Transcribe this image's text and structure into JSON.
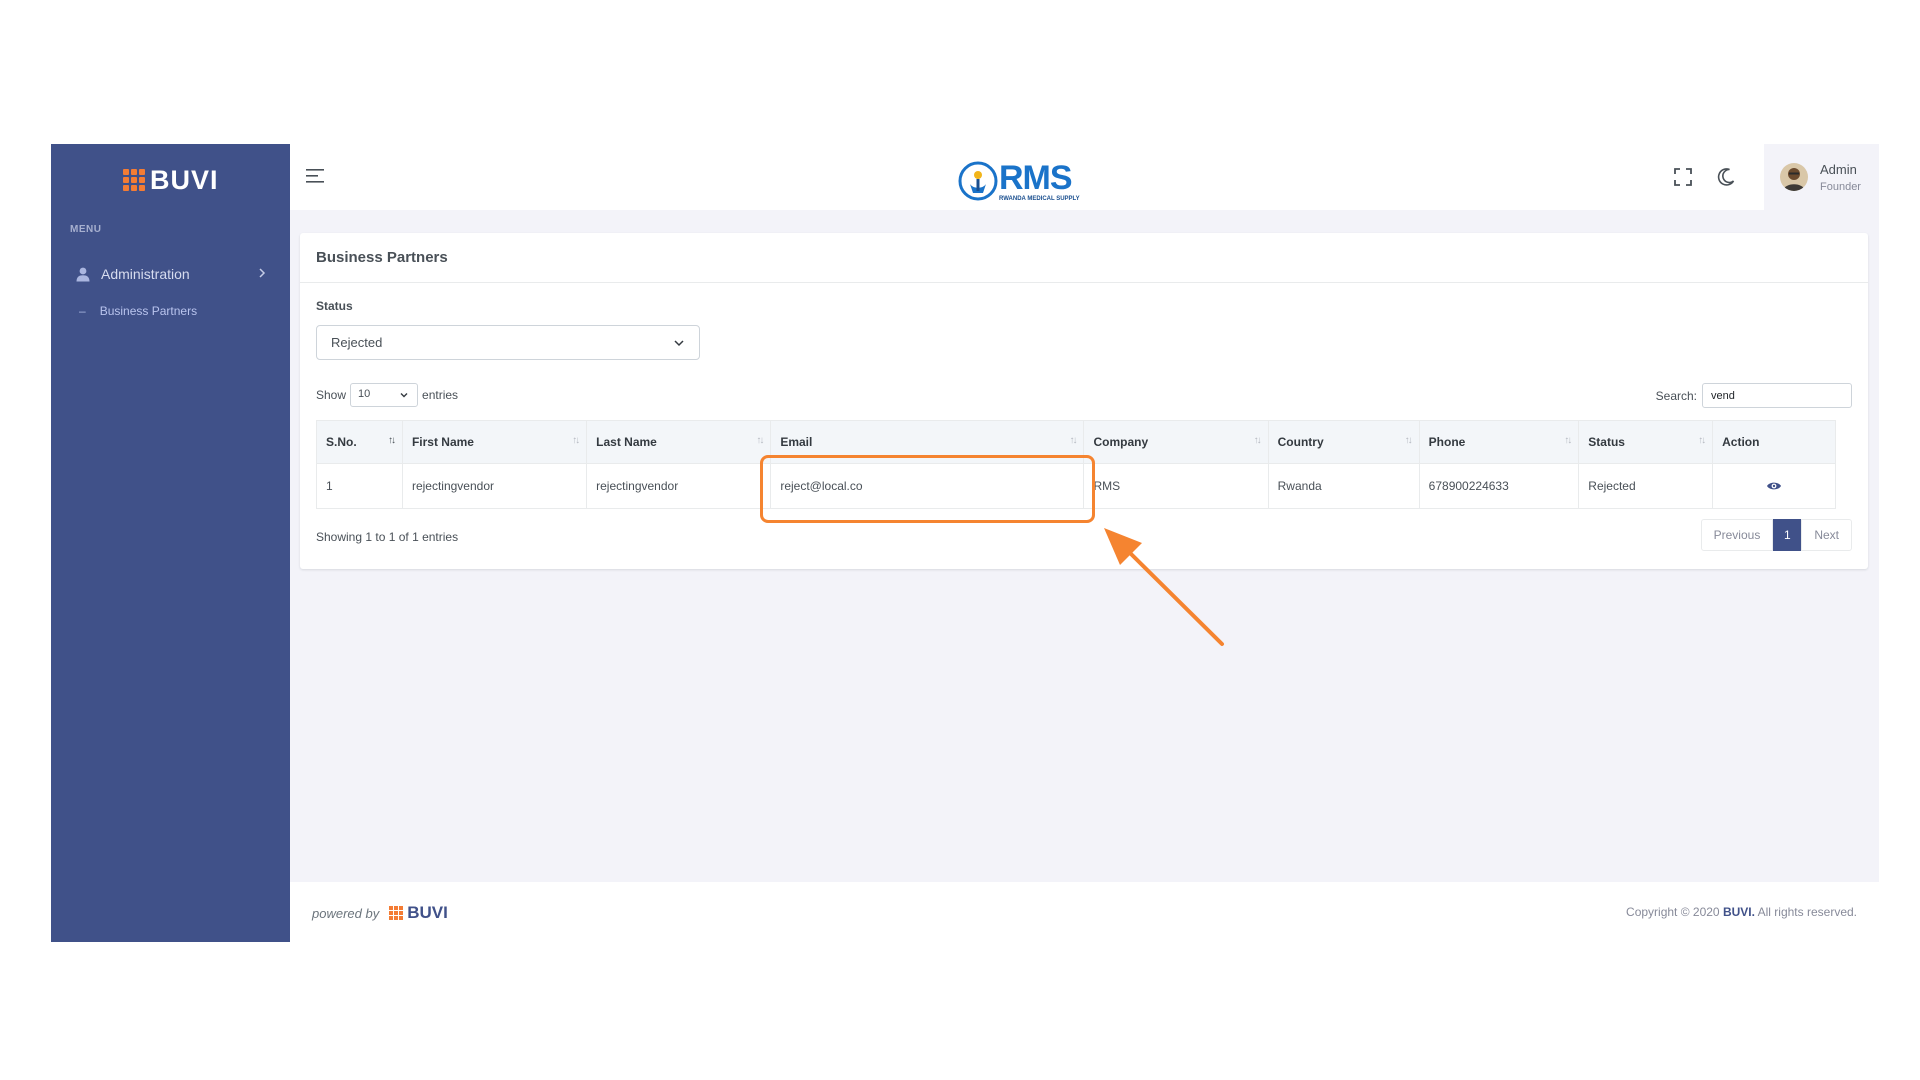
{
  "sidebar": {
    "brand": "BUVI",
    "menu_title": "MENU",
    "items": [
      {
        "label": "Administration",
        "icon": "user-icon"
      }
    ],
    "sub_items": [
      {
        "label": "Business Partners"
      }
    ]
  },
  "header": {
    "logo_main": "RMS",
    "logo_sub": "RWANDA MEDICAL SUPPLY",
    "user": {
      "name": "Admin",
      "role": "Founder"
    }
  },
  "card": {
    "title": "Business Partners",
    "status_label": "Status",
    "status_value": "Rejected",
    "show_label": "Show",
    "entries_value": "10",
    "entries_label": "entries",
    "search_label": "Search:",
    "search_value": "vend",
    "columns": [
      "S.No.",
      "First Name",
      "Last Name",
      "Email",
      "Company",
      "Country",
      "Phone",
      "Status",
      "Action"
    ],
    "rows": [
      {
        "sno": "1",
        "first_name": "rejectingvendor",
        "last_name": "rejectingvendor",
        "email": "reject@local.co",
        "company": "RMS",
        "country": "Rwanda",
        "phone": "678900224633",
        "status": "Rejected"
      }
    ],
    "info": "Showing 1 to 1 of 1 entries",
    "pagination": {
      "previous": "Previous",
      "current": "1",
      "next": "Next"
    }
  },
  "footer": {
    "powered_by": "powered by",
    "brand": "BUVI",
    "copyright_prefix": "Copyright © 2020",
    "copyright_brand": "BUVI.",
    "copyright_suffix": "All rights reserved."
  },
  "colors": {
    "sidebar": "#405189",
    "accent_orange": "#f58430",
    "brand_orange": "#f47c34",
    "page_bg": "#f3f3f9"
  }
}
